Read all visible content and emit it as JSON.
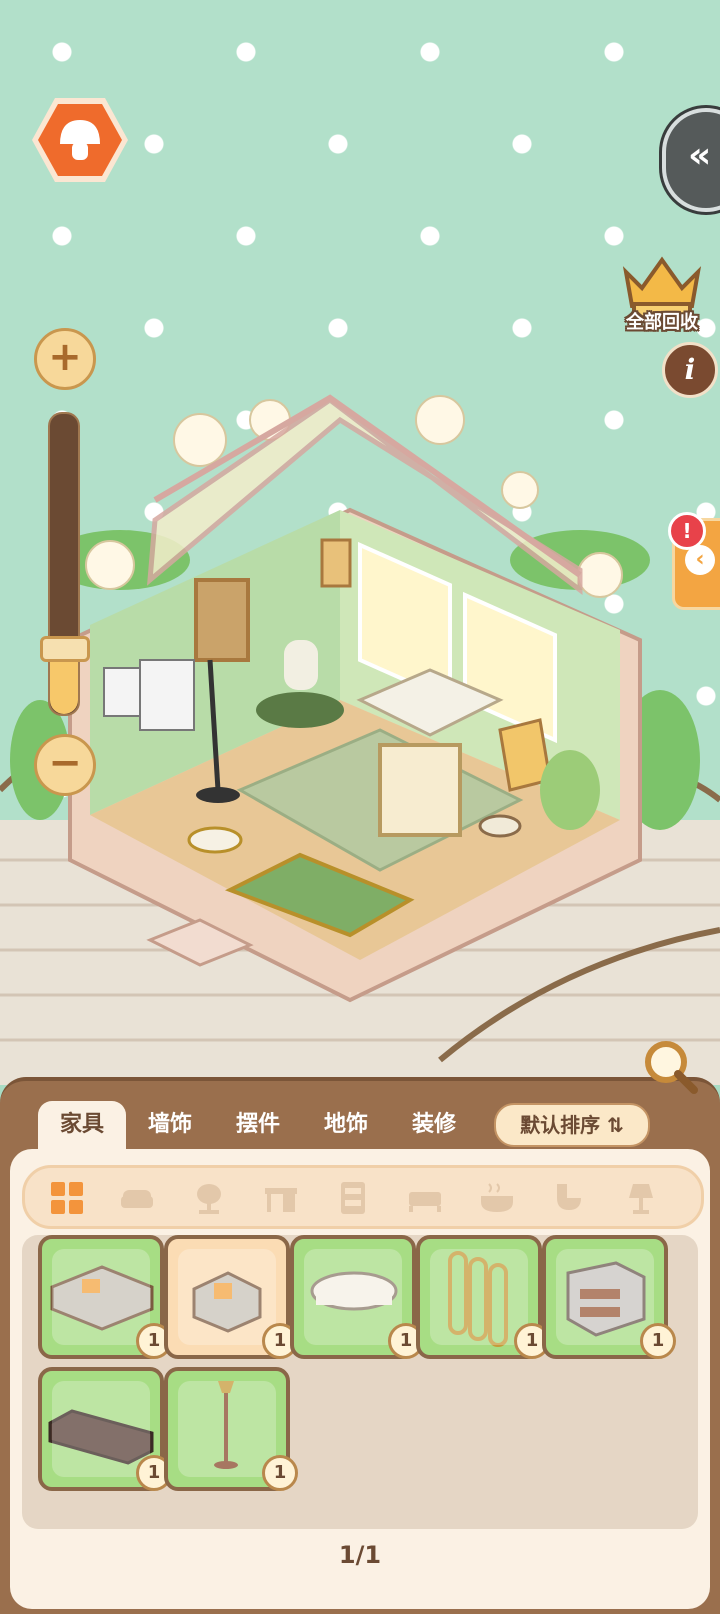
{
  "top_right": {
    "collapse_glyph": "«",
    "recycle_all_label": "全部回收",
    "info_glyph": "i",
    "alert_glyph": "!",
    "side_chevron": "‹"
  },
  "zoom": {
    "plus": "+",
    "minus": "−",
    "level": 0.22
  },
  "tabs": [
    {
      "label": "家具",
      "active": true
    },
    {
      "label": "墙饰",
      "active": false
    },
    {
      "label": "摆件",
      "active": false
    },
    {
      "label": "地饰",
      "active": false
    },
    {
      "label": "装修",
      "active": false
    }
  ],
  "sort": {
    "label": "默认排序 ⇅"
  },
  "categories": [
    "grid-icon",
    "sofa-icon",
    "chair-icon",
    "desk-icon",
    "cabinet-icon",
    "bed-icon",
    "bathtub-icon",
    "toilet-icon",
    "lamp-icon"
  ],
  "items": [
    {
      "name": "sofa",
      "count": "1",
      "selected": false
    },
    {
      "name": "armchair",
      "count": "1",
      "selected": true
    },
    {
      "name": "coffee-table",
      "count": "1",
      "selected": false
    },
    {
      "name": "folding-screen",
      "count": "1",
      "selected": false
    },
    {
      "name": "drawer-cabinet",
      "count": "1",
      "selected": false
    },
    {
      "name": "tv-bench",
      "count": "1",
      "selected": false
    },
    {
      "name": "floor-lamp",
      "count": "1",
      "selected": false
    }
  ],
  "pagination": "1/1",
  "colors": {
    "panel": "#9a6f4d",
    "card_bg": "#a7dd84",
    "card_selected": "#fbdcb4",
    "accent": "#f3a542"
  }
}
